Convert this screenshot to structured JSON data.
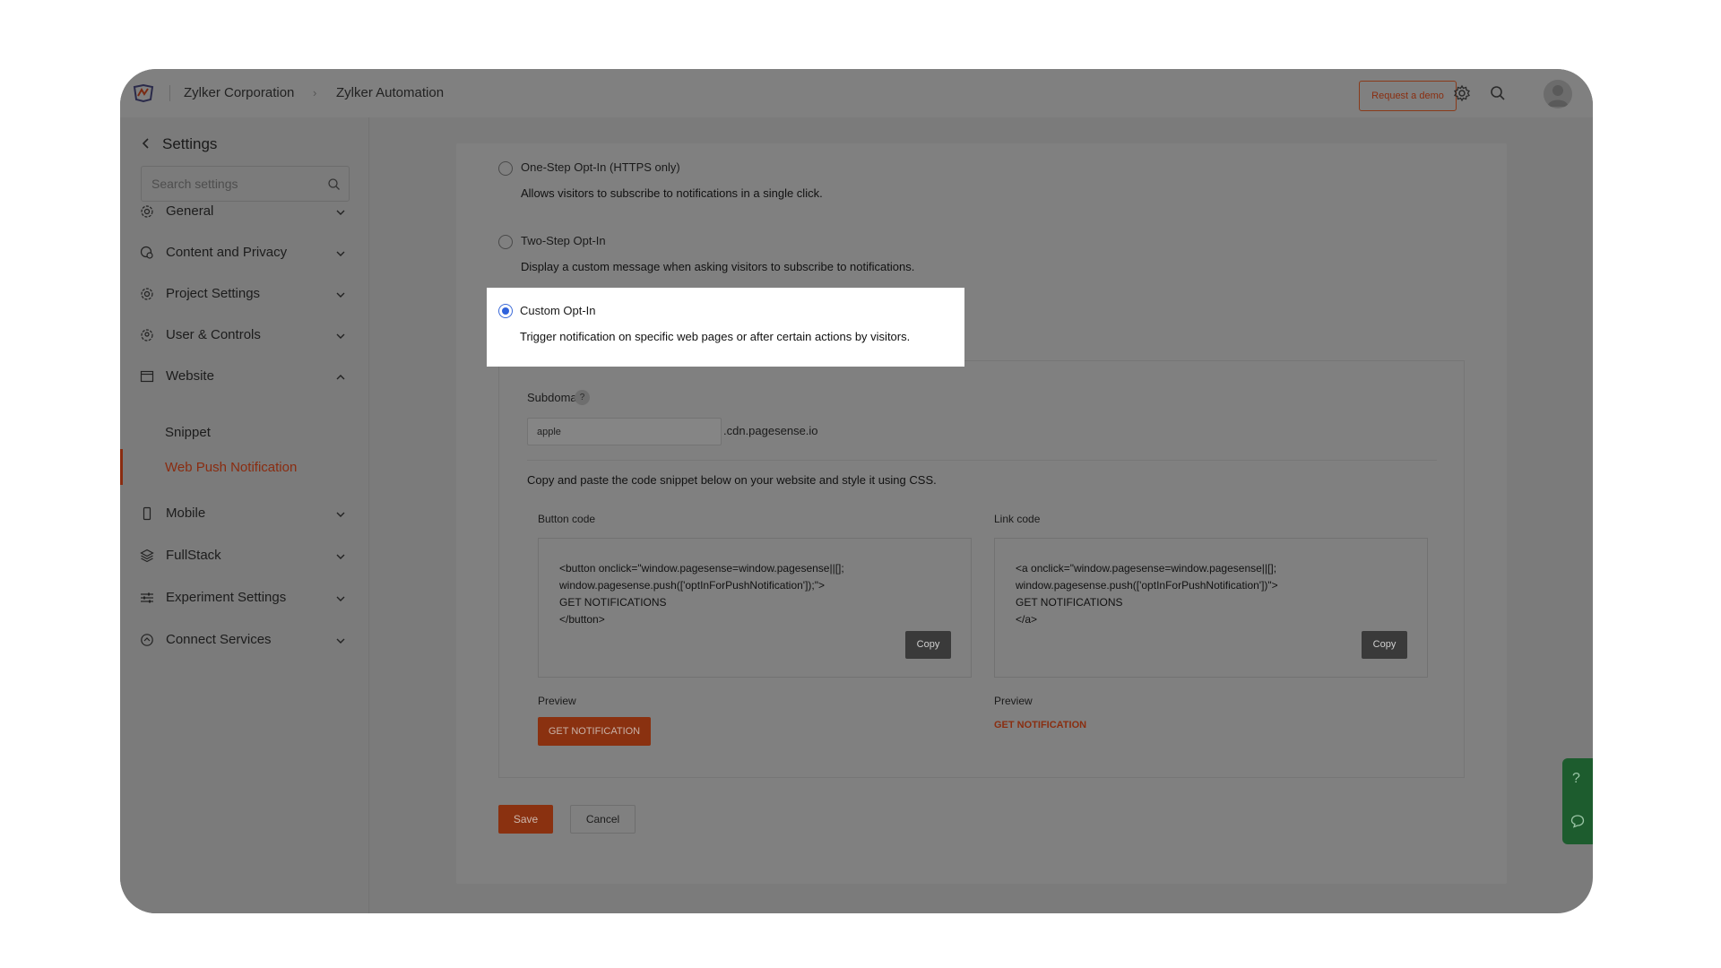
{
  "header": {
    "org": "Zylker Corporation",
    "separator": "›",
    "project": "Zylker Automation",
    "demo_button": "Request a demo"
  },
  "sidebar": {
    "title": "Settings",
    "search_placeholder": "Search settings",
    "items": [
      {
        "label": "General",
        "icon": "gear-icon",
        "expanded": false
      },
      {
        "label": "Content and Privacy",
        "icon": "privacy-icon",
        "expanded": false
      },
      {
        "label": "Project Settings",
        "icon": "gear-icon",
        "expanded": false
      },
      {
        "label": "User & Controls",
        "icon": "user-gear-icon",
        "expanded": false
      },
      {
        "label": "Website",
        "icon": "browser-icon",
        "expanded": true
      },
      {
        "label": "Mobile",
        "icon": "mobile-icon",
        "expanded": false
      },
      {
        "label": "FullStack",
        "icon": "layers-icon",
        "expanded": false
      },
      {
        "label": "Experiment Settings",
        "icon": "sliders-icon",
        "expanded": false
      },
      {
        "label": "Connect Services",
        "icon": "connect-icon",
        "expanded": false
      }
    ],
    "website_sub": [
      {
        "label": "Snippet",
        "active": false
      },
      {
        "label": "Web Push Notification",
        "active": true
      }
    ]
  },
  "options": [
    {
      "title": "One-Step Opt-In (HTTPS only)",
      "desc": "Allows visitors to subscribe to notifications in a single click.",
      "selected": false
    },
    {
      "title": "Two-Step Opt-In",
      "desc": "Display a custom message when asking visitors to subscribe to notifications.",
      "selected": false
    },
    {
      "title": "Custom Opt-In",
      "desc": "Trigger notification on specific web pages or after certain actions by visitors.",
      "selected": true
    }
  ],
  "custom": {
    "subdomain_label": "Subdomain",
    "help": "?",
    "subdomain_value": "apple",
    "subdomain_suffix": ".cdn.pagesense.io",
    "instructions": "Copy and paste the code snippet below on your website and style it using CSS.",
    "button_code_label": "Button code",
    "button_code": "<button onclick=\"window.pagesense=window.pagesense||[];\nwindow.pagesense.push(['optInForPushNotification']);\">\nGET NOTIFICATIONS\n</button>",
    "link_code_label": "Link code",
    "link_code": "<a onclick=\"window.pagesense=window.pagesense||[];\nwindow.pagesense.push(['optInForPushNotification'])\">\nGET NOTIFICATIONS\n</a>",
    "copy": "Copy",
    "preview_label": "Preview",
    "preview_button": "GET NOTIFICATION",
    "preview_link": "GET NOTIFICATION"
  },
  "actions": {
    "save": "Save",
    "cancel": "Cancel"
  },
  "floating": {
    "help": "?"
  },
  "colors": {
    "accent": "#e9692c",
    "radio_selected": "#2f62dc",
    "help_panel": "#2f9a4b"
  }
}
